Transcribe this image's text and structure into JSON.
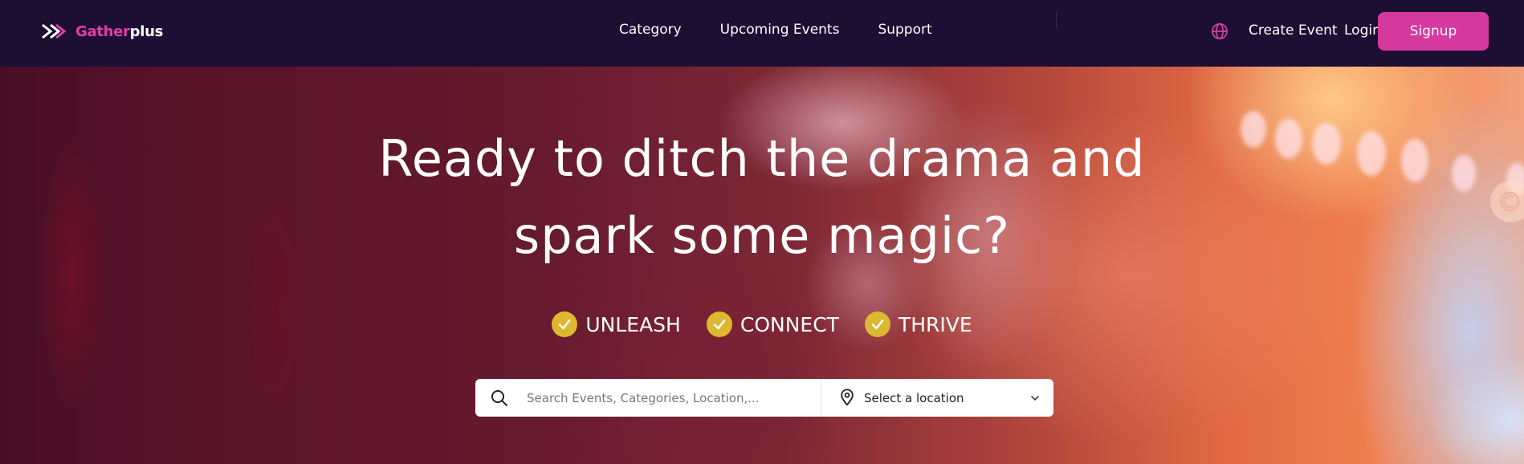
{
  "brand": {
    "name_part1": "Gather",
    "name_part2": "plus",
    "color_primary": "#e03ea5",
    "color_nav_bg": "#1c0f33"
  },
  "nav": {
    "links": [
      "Category",
      "Upcoming Events",
      "Support"
    ],
    "language_icon": "globe-icon",
    "create_event_label": "Create Event",
    "login_label": "Login",
    "signup_label": "Signup"
  },
  "hero": {
    "headline_line1": "Ready to ditch the drama and",
    "headline_line2": "spark some magic?",
    "pills": [
      "UNLEASH",
      "CONNECT",
      "THRIVE"
    ],
    "pill_icon": "check-icon",
    "pill_color": "#ddb831"
  },
  "search": {
    "placeholder": "Search Events, Categories, Location,...",
    "search_icon": "search-icon",
    "location_icon": "map-pin-icon",
    "location_label": "Select a location"
  }
}
